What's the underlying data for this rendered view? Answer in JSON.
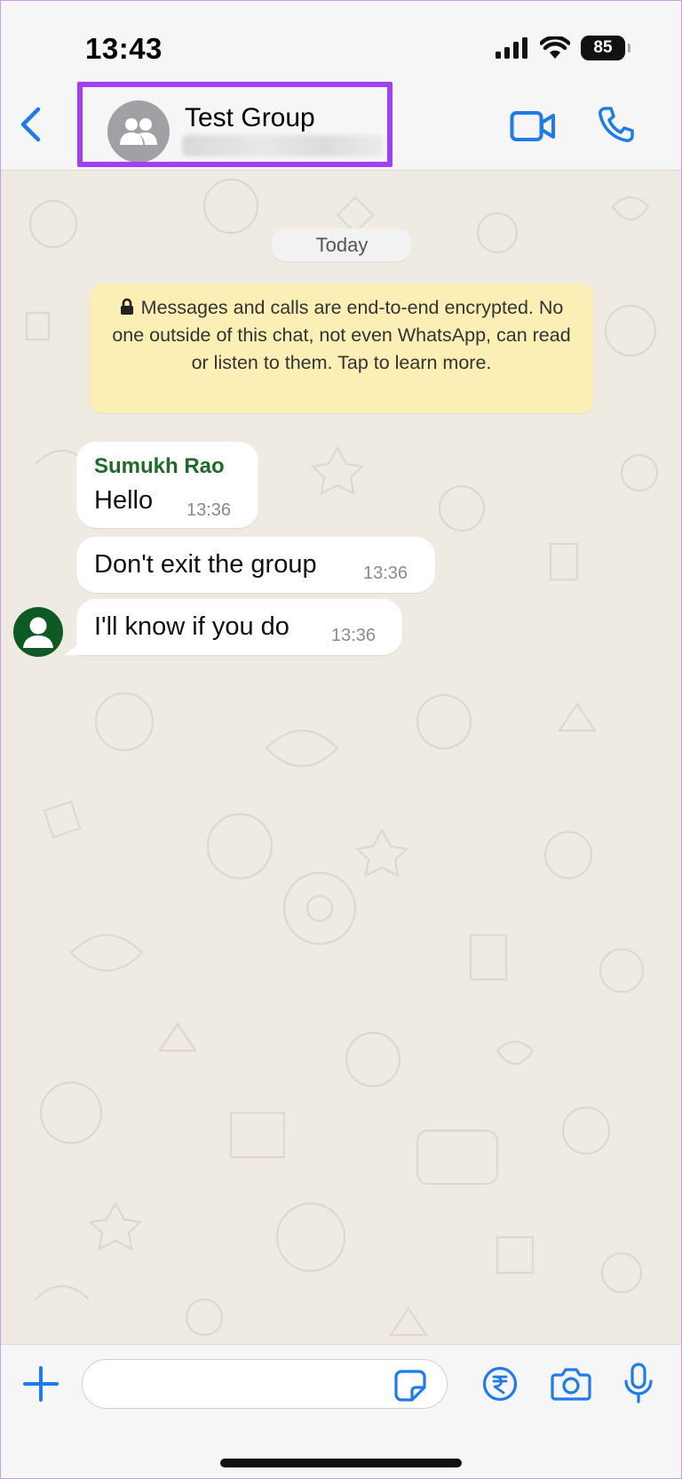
{
  "status_bar": {
    "time": "13:43",
    "battery": "85"
  },
  "header": {
    "title": "Test Group",
    "back_icon": "chevron-left-icon",
    "video_icon": "video-camera-icon",
    "call_icon": "phone-icon",
    "highlight_color": "#a23ff0"
  },
  "chat": {
    "date_label": "Today",
    "encryption_notice": "Messages and calls are end-to-end encrypted. No one outside of this chat, not even WhatsApp, can read or listen to them. Tap to learn more.",
    "messages": [
      {
        "sender": "Sumukh Rao",
        "text": "Hello",
        "time": "13:36"
      },
      {
        "sender": "",
        "text": "Don't exit the group",
        "time": "13:36"
      },
      {
        "sender": "",
        "text": "I'll know if you do",
        "time": "13:36"
      }
    ]
  },
  "input_bar": {
    "placeholder": "",
    "icons": [
      "plus-icon",
      "sticker-icon",
      "rupee-payment-icon",
      "camera-icon",
      "microphone-icon"
    ]
  },
  "colors": {
    "accent": "#1f7aeb",
    "chat_background": "#efeae2",
    "encryption_bg": "#fcefb6",
    "sender_name": "#1e6b28"
  }
}
